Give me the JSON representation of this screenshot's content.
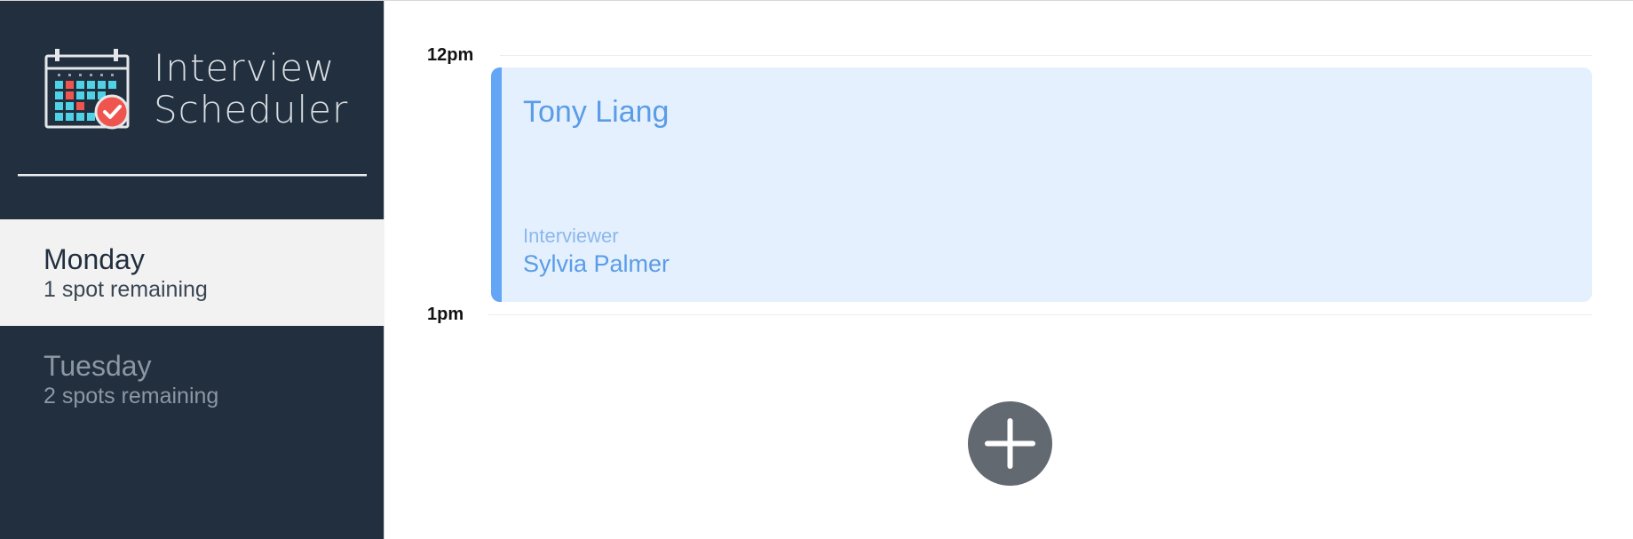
{
  "app": {
    "title_line1": "Interview",
    "title_line2": "Scheduler",
    "logo_icon": "calendar-check-icon"
  },
  "sidebar": {
    "days": [
      {
        "name": "Monday",
        "spots": "1 spot remaining",
        "selected": true
      },
      {
        "name": "Tuesday",
        "spots": "2 spots remaining",
        "selected": false
      }
    ]
  },
  "schedule": {
    "times": [
      "12pm",
      "1pm"
    ],
    "appointment": {
      "student": "Tony Liang",
      "interviewer_label": "Interviewer",
      "interviewer": "Sylvia Palmer"
    },
    "add_icon": "plus-icon"
  },
  "colors": {
    "sidebar_bg": "#222f3e",
    "selected_day_bg": "#f2f2f2",
    "appointment_bg": "#e4f0fe",
    "appointment_accent": "#63a6f5",
    "add_button": "#636971"
  }
}
